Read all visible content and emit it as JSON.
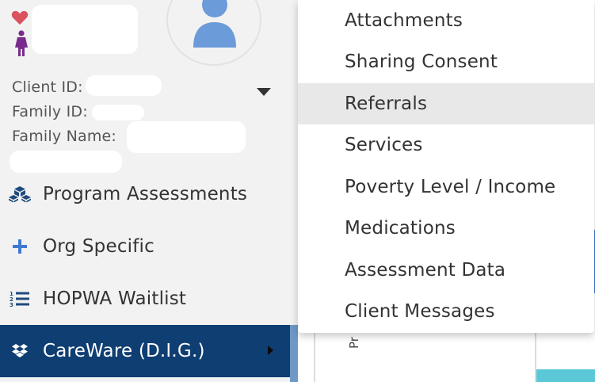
{
  "client": {
    "id_label": "Client ID:",
    "family_id_label": "Family ID:",
    "family_name_label": "Family Name:"
  },
  "nav": [
    {
      "label": "Program Assessments",
      "icon": "cubes-icon"
    },
    {
      "label": "Org Specific",
      "icon": "plus-icon"
    },
    {
      "label": "HOPWA Waitlist",
      "icon": "numbered-list-icon"
    },
    {
      "label": "CareWare (D.I.G.)",
      "icon": "dropbox-icon",
      "active": true
    }
  ],
  "menu": {
    "items": [
      "Attachments",
      "Sharing Consent",
      "Referrals",
      "Services",
      "Poverty Level / Income",
      "Medications",
      "Assessment Data",
      "Client Messages"
    ],
    "hovered_index": 2
  },
  "peek_text": "Pr",
  "colors": {
    "active_nav_bg": "#0f3e72",
    "accent_blue": "#3f7ad1",
    "heart": "#d9535f",
    "person": "#7a2a8c",
    "teal": "#5bc8d8"
  }
}
